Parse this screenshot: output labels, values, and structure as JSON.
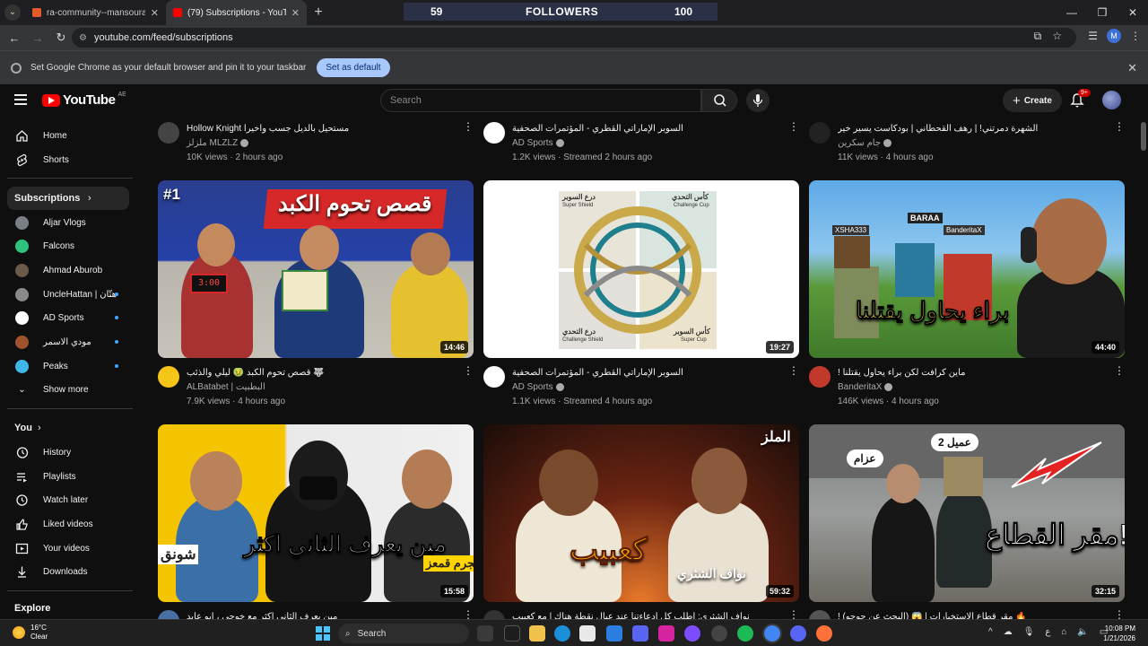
{
  "browser": {
    "tabs": [
      {
        "title": "ra-community--mansouralk3b",
        "favicon_color": "#e55a2b"
      },
      {
        "title": "(79) Subscriptions - YouTube",
        "favicon_color": "#ff0000"
      }
    ],
    "url": "youtube.com/feed/subscriptions",
    "profile_initial": "M",
    "infobar": {
      "text": "Set Google Chrome as your default browser and pin it to your taskbar",
      "button": "Set as default"
    }
  },
  "stream_overlay": {
    "left_count": "59",
    "label": "FOLLOWERS",
    "right_count": "100"
  },
  "youtube": {
    "logo": "YouTube",
    "country": "AE",
    "search_placeholder": "Search",
    "create_label": "Create",
    "notif_badge": "9+"
  },
  "sidebar": {
    "top": [
      {
        "label": "Home",
        "icon": "home-icon"
      },
      {
        "label": "Shorts",
        "icon": "shorts-icon"
      }
    ],
    "subs_header": "Subscriptions",
    "subs": [
      {
        "label": "Aljar Vlogs",
        "color": "#7a7f86",
        "dot": false
      },
      {
        "label": "Falcons",
        "color": "#2ec27e",
        "dot": false
      },
      {
        "label": "Ahmad Aburob",
        "color": "#6b5a4a",
        "dot": false
      },
      {
        "label": "UncleHattan | هتّان",
        "color": "#8a8a8a",
        "dot": true
      },
      {
        "label": "AD Sports",
        "color": "#ffffff",
        "dot": true
      },
      {
        "label": "مودي الاسمر",
        "color": "#a0522d",
        "dot": true
      },
      {
        "label": "Peaks",
        "color": "#3fb5e8",
        "dot": true
      }
    ],
    "show_more": "Show more",
    "you_header": "You",
    "you": [
      {
        "label": "History",
        "icon": "history-icon"
      },
      {
        "label": "Playlists",
        "icon": "playlists-icon"
      },
      {
        "label": "Watch later",
        "icon": "watch-later-icon"
      },
      {
        "label": "Liked videos",
        "icon": "liked-videos-icon"
      },
      {
        "label": "Your videos",
        "icon": "your-videos-icon"
      },
      {
        "label": "Downloads",
        "icon": "downloads-icon"
      }
    ],
    "explore_header": "Explore"
  },
  "row_top": [
    {
      "title": "Hollow Knight مستحيل بالديل جسب واخيرا",
      "channel": "ملزلز MLZLZ",
      "views": "10K views · 2 hours ago",
      "avatar": "#444"
    },
    {
      "title": "السوبر الإماراتي القطري - المؤتمرات الصحفية",
      "channel": "AD Sports",
      "views": "1.2K views · Streamed 2 hours ago",
      "avatar": "#ffffff"
    },
    {
      "title": "الشهرة دمرتني! | رهف القحطاني | بودكاست يسير خير",
      "channel": "جام سكرين",
      "views": "11K views · 4 hours ago",
      "avatar": "#222"
    }
  ],
  "row_mid": [
    {
      "title": "قصص تحوم الكبد 🤢 ليلي والذئب 🐺",
      "channel": "ALBatabet | البطبيت",
      "views": "7.9K views · 4 hours ago",
      "duration": "14:46",
      "thumb_text": "قصص تحوم الكبد",
      "badge": "#1",
      "avatar": "#f5c518"
    },
    {
      "title": "السوبر الإماراتي القطري - المؤتمرات الصحفية",
      "channel": "AD Sports",
      "views": "1.1K views · Streamed 4 hours ago",
      "duration": "19:27",
      "labels": [
        "درع السوبر",
        "Super Shield",
        "كأس التحدي",
        "Challenge Cup",
        "درع التحدي",
        "Challenge Shield",
        "كأس السوبر",
        "Super Cup"
      ],
      "avatar": "#ffffff"
    },
    {
      "title": "! ماين كرافت لكن براء يحاول يقتلنا",
      "channel": "BanderitaX",
      "views": "146K views · 4 hours ago",
      "duration": "44:40",
      "thumb_text": "براء يحاول يقتلنا",
      "tag1": "BARAA",
      "tag2": "BanderitaX",
      "tag3": "XSHA333",
      "avatar": "#c0392b"
    }
  ],
  "row_bottom": [
    {
      "duration": "15:58",
      "thumb_text": "مين يعرف الثاني اكثر",
      "side_left": "شونق",
      "side_right": "مجرم قمعز"
    },
    {
      "duration": "59:32",
      "thumb_text": "كعبيب",
      "sub_text": "نواف الشثري",
      "logo": "الملز"
    },
    {
      "duration": "32:15",
      "thumb_text": "مقر القطاع!",
      "tag1": "عزام",
      "tag2": "عميل 2"
    }
  ],
  "row_bottom_titles": [
    "مين يعرف الثاني اكثر مع خوجي ، ابو عابد",
    "نواف الشثري: أطلب كل ادعاءتنا عند عيال نقطة هناك | مع كعبيب",
    "! (البحث عن جوجو) 😱 | مقر قطاع الاستخبارات 🔥"
  ],
  "taskbar": {
    "temp": "16°C",
    "condition": "Clear",
    "search": "Search",
    "time": "10:08 PM",
    "date": "1/21/2026"
  }
}
